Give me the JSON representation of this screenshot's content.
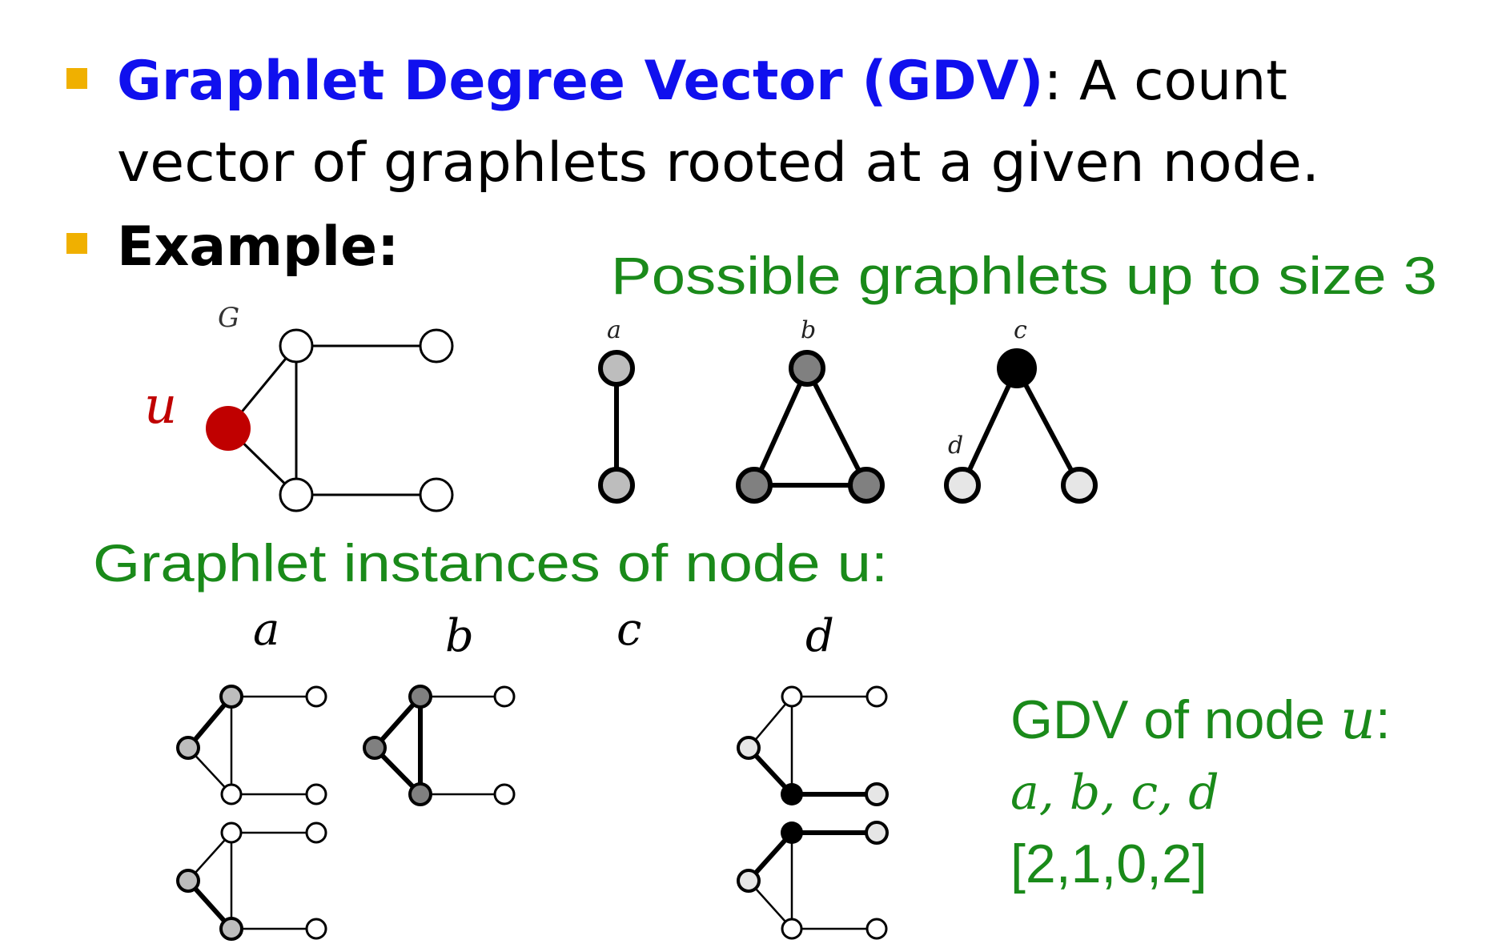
{
  "bullets": [
    {
      "term": "Graphlet Degree Vector (GDV)",
      "sep": ": ",
      "line1_rest": "A count",
      "line2": "vector of graphlets rooted at a given node."
    },
    {
      "term": "Example:"
    }
  ],
  "possible_title": "Possible graphlets up to size 3",
  "instances_title": "Graphlet instances of node u:",
  "graph_label": "G",
  "node_label": "u",
  "graphlet_labels": [
    "a",
    "b",
    "c",
    "d"
  ],
  "instance_columns": [
    "a",
    "b",
    "c",
    "d"
  ],
  "gdv": {
    "title_prefix": "GDV of node ",
    "title_var": "u",
    "title_suffix": ":",
    "orbits": "a, b, c, d",
    "vector": "[2,1,0,2]"
  },
  "colors": {
    "bullet": "#F0B000",
    "term": "#1010EE",
    "green": "#1A8A1A",
    "node_u": "#C00000",
    "orbit_a": "#BDBDBD",
    "orbit_b": "#808080",
    "orbit_c": "#000000",
    "orbit_d": "#E6E6E6"
  }
}
